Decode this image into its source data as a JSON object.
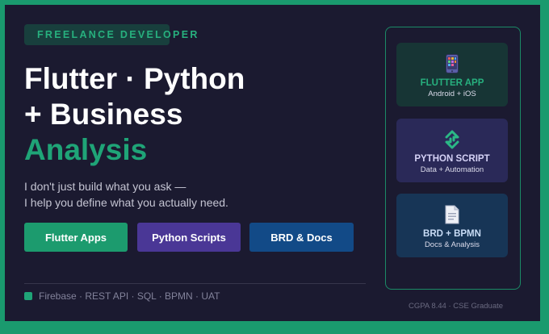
{
  "badge": {
    "label": "FREELANCE DEVELOPER"
  },
  "headline": {
    "line1": "Flutter · Python",
    "line2": "+ Business",
    "line3": "Analysis"
  },
  "tagline": {
    "line1": "I don't just build what you ask —",
    "line2": "I help you define what you actually need."
  },
  "buttons": [
    {
      "label": "Flutter Apps",
      "color": "#1c9b6e"
    },
    {
      "label": "Python Scripts",
      "color": "#4a3796"
    },
    {
      "label": "BRD & Docs",
      "color": "#124a87"
    }
  ],
  "tech": {
    "text": "Firebase · REST API · SQL · BPMN · UAT"
  },
  "cards": [
    {
      "icon": "phone-app-icon",
      "title": "FLUTTER APP",
      "subtitle": "Android + iOS"
    },
    {
      "icon": "python-script-icon",
      "title": "PYTHON SCRIPT",
      "subtitle": "Data + Automation"
    },
    {
      "icon": "document-icon",
      "title": "BRD + BPMN",
      "subtitle": "Docs & Analysis"
    }
  ],
  "footer": {
    "note": "CGPA 8.44 · CSE Graduate"
  },
  "colors": {
    "background": "#1b1a30",
    "accent": "#1fa477",
    "frame": "#1a9a6e"
  }
}
